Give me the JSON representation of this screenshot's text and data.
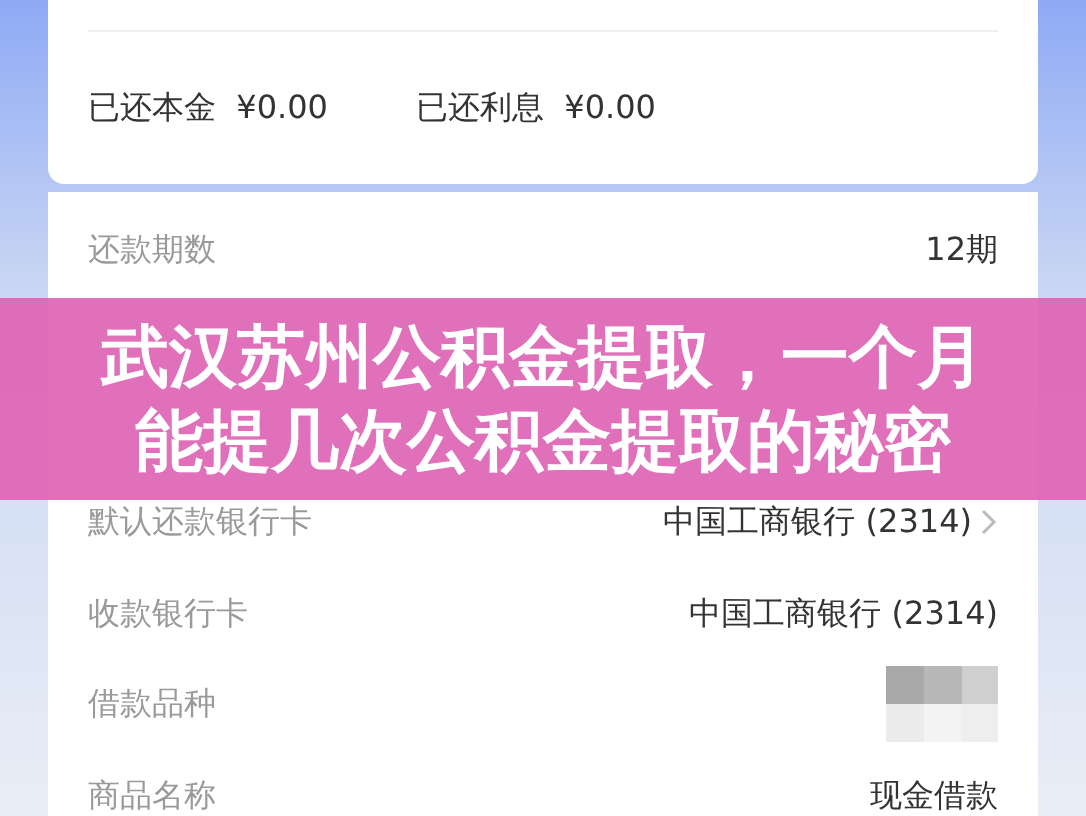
{
  "summary": [
    {
      "label": "已还本金",
      "amount": "¥0.00"
    },
    {
      "label": "已还利息",
      "amount": "¥0.00"
    }
  ],
  "details": [
    {
      "label": "还款期数",
      "value": "12期",
      "link": false,
      "kind": "text"
    },
    {
      "kind": "hidden"
    },
    {
      "kind": "hidden"
    },
    {
      "label": "默认还款银行卡",
      "value": "中国工商银行 (2314)",
      "link": true,
      "kind": "text"
    },
    {
      "label": "收款银行卡",
      "value": "中国工商银行 (2314)",
      "link": false,
      "kind": "text"
    },
    {
      "label": "借款品种",
      "kind": "redacted"
    },
    {
      "label": "商品名称",
      "value": "现金借款",
      "link": false,
      "kind": "text"
    }
  ],
  "banner": {
    "lines": [
      "武汉苏州公积金提取，一个月",
      "能提几次公积金提取的秘密"
    ]
  }
}
